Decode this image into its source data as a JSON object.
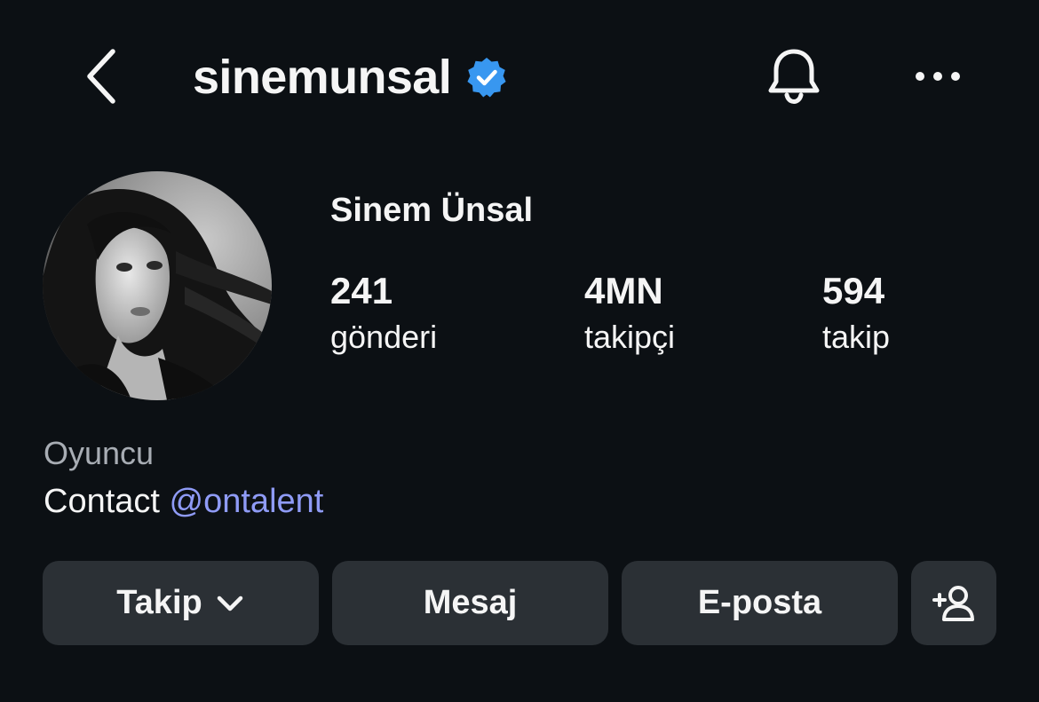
{
  "header": {
    "back_icon": "chevron-left-icon",
    "username": "sinemunsal",
    "verified_icon": "verified-badge-icon",
    "notifications_icon": "bell-icon",
    "more_icon": "more-horizontal-icon"
  },
  "profile": {
    "display_name": "Sinem Ünsal",
    "avatar": "avatar-photo",
    "stats": [
      {
        "value": "241",
        "label": "gönderi"
      },
      {
        "value": "4MN",
        "label": "takipçi"
      },
      {
        "value": "594",
        "label": "takip"
      }
    ]
  },
  "bio": {
    "category": "Oyuncu",
    "contact_prefix": "Contact ",
    "contact_handle": "@ontalent"
  },
  "actions": {
    "follow_label": "Takip",
    "follow_icon": "chevron-down-icon",
    "message_label": "Mesaj",
    "email_label": "E-posta",
    "add_user_icon": "add-user-icon"
  },
  "colors": {
    "background": "#0c1014",
    "text": "#f5f5f5",
    "muted_text": "#a8adb4",
    "link": "#8f9bf6",
    "button_bg": "#2b3035",
    "verified_blue": "#3897f0"
  }
}
